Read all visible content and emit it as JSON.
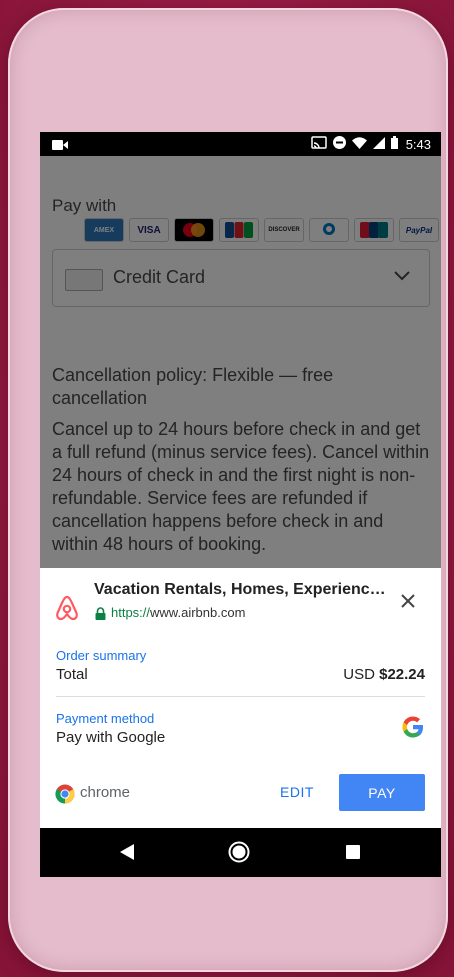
{
  "status_bar": {
    "time": "5:43",
    "icons": [
      "video-camera-icon",
      "cast-icon",
      "do-not-disturb-icon",
      "wifi-icon",
      "signal-icon",
      "battery-icon"
    ]
  },
  "background_page": {
    "pay_with_label": "Pay with",
    "card_brands": [
      "AMEX",
      "VISA",
      "Mastercard",
      "JCB",
      "DISCOVER",
      "Diners Club",
      "UnionPay",
      "PayPal"
    ],
    "payment_select": {
      "value": "Credit Card"
    },
    "cancellation": {
      "title": "Cancellation policy: Flexible — free cancellation",
      "text": "Cancel up to 24 hours before check in and get a full refund (minus service fees). Cancel within 24 hours of check in and the first night is non-refundable. Service fees are refunded if cancellation happens before check in and within 48 hours of booking."
    }
  },
  "payment_sheet": {
    "site_title": "Vacation Rentals, Homes, Experiences &...",
    "url_scheme": "https://",
    "url_host": "www.airbnb.com",
    "order_summary_label": "Order summary",
    "total_label": "Total",
    "total_currency": "USD",
    "total_amount": "$22.24",
    "payment_method_label": "Payment method",
    "payment_method_value": "Pay with Google",
    "browser_label": "chrome",
    "edit_label": "EDIT",
    "pay_label": "PAY"
  },
  "colors": {
    "accent_blue": "#1a73e8",
    "pay_button": "#4285f4",
    "airbnb": "#ff5a5f",
    "secure_green": "#0b8043",
    "backdrop": "#9e1f4a"
  }
}
